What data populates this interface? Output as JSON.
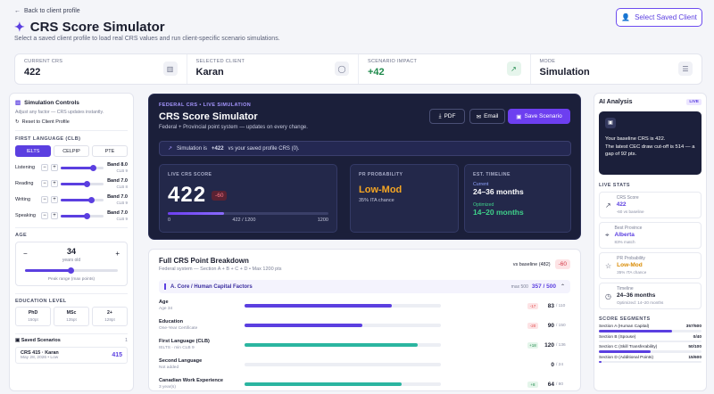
{
  "header": {
    "back_label": "Back to client profile",
    "title": "CRS Score Simulator",
    "subtitle": "Select a saved client profile to load real CRS values and run client-specific scenario simulations.",
    "select_button": "Select Saved Client"
  },
  "stats": [
    {
      "label": "CURRENT CRS",
      "value": "422",
      "icon": "chart-icon"
    },
    {
      "label": "SELECTED CLIENT",
      "value": "Karan",
      "icon": "user-icon"
    },
    {
      "label": "SCENARIO IMPACT",
      "value": "+42",
      "icon": "trend-up-icon",
      "color": "#1f8a4c"
    },
    {
      "label": "MODE",
      "value": "Simulation",
      "icon": "sliders-icon"
    }
  ],
  "controls": {
    "title": "Simulation Controls",
    "subtitle": "Adjust any factor — CRS updates instantly.",
    "reset": "Reset to Client Profile",
    "language_label": "FIRST LANGUAGE (CLB)",
    "tests": [
      "IELTS",
      "CELPIP",
      "PTE"
    ],
    "skills": [
      {
        "name": "Listening",
        "band": "Band 8.0",
        "clb": "CLB 9",
        "level": 0.75
      },
      {
        "name": "Reading",
        "band": "Band 7.0",
        "clb": "CLB 8",
        "level": 0.6
      },
      {
        "name": "Writing",
        "band": "Band 7.0",
        "clb": "CLB 9",
        "level": 0.7
      },
      {
        "name": "Speaking",
        "band": "Band 7.0",
        "clb": "CLB 9",
        "level": 0.6
      }
    ],
    "age_label": "AGE",
    "age_value": "34",
    "age_unit": "years old",
    "age_caption": "Peak range (max points)",
    "education_label": "EDUCATION LEVEL",
    "education": [
      {
        "name": "PhD",
        "pts": "150pt"
      },
      {
        "name": "MSc",
        "pts": "135pt"
      },
      {
        "name": "2+",
        "pts": "128pt"
      }
    ],
    "saved_label": "Saved Scenarios",
    "saved_count": "1",
    "saved_item": {
      "name": "CRS 415 · Karan",
      "meta": "May 28, 2026 • Low",
      "score": "415"
    }
  },
  "hero": {
    "tag": "FEDERAL CRS • LIVE SIMULATION",
    "title": "CRS Score Simulator",
    "subtitle": "Federal + Provincial point system — updates on every change.",
    "pdf": "PDF",
    "email": "Email",
    "save": "Save Scenario",
    "banner_pre": "Simulation is",
    "banner_bold": "+422",
    "banner_post": "vs your saved profile CRS (0).",
    "live_label": "LIVE CRS SCORE",
    "live_value": "422",
    "live_delta": "-60",
    "bar_min": "0",
    "bar_mid": "422 / 1200",
    "bar_max": "1200",
    "live_fraction": 0.352,
    "prob_label": "PR PROBABILITY",
    "prob_value": "Low-Mod",
    "prob_sub": "35% ITA chance",
    "timeline_label": "EST. TIMELINE",
    "current_label": "Current",
    "current_value": "24–36 months",
    "optimized_label": "Optimized",
    "optimized_value": "14–20 months"
  },
  "breakdown": {
    "title": "Full CRS Point Breakdown",
    "subtitle": "Federal system — Section A + B + C + D • Max 1200 pts",
    "baseline": "vs baseline (482)",
    "baseline_delta": "-60",
    "section": "A. Core / Human Capital Factors",
    "section_max": "max 500",
    "section_score": "357 / 500",
    "rows": [
      {
        "name": "Age",
        "sub": "Age 34",
        "delta": "-17",
        "value": "83",
        "max": "/ 110",
        "fill": 0.75,
        "color": "#5b3fe0",
        "dcolor": "#e04a4a"
      },
      {
        "name": "Education",
        "sub": "One-Year Certificate",
        "delta": "-20",
        "value": "90",
        "max": "/ 150",
        "fill": 0.6,
        "color": "#5b3fe0",
        "dcolor": "#e04a4a"
      },
      {
        "name": "First Language (CLB)",
        "sub": "IELTS - min CLB 9",
        "delta": "+18",
        "value": "120",
        "max": "/ 136",
        "fill": 0.88,
        "color": "#2bb5a0",
        "dcolor": "#1f8a4c"
      },
      {
        "name": "Second Language",
        "sub": "Not added",
        "delta": "",
        "value": "0",
        "max": "/ 24",
        "fill": 0,
        "color": "#5b3fe0",
        "dcolor": "#8a8fa5"
      },
      {
        "name": "Canadian Work Experience",
        "sub": "3 year(s)",
        "delta": "+8",
        "value": "64",
        "max": "/ 80",
        "fill": 0.8,
        "color": "#2bb5a0",
        "dcolor": "#1f8a4c"
      }
    ]
  },
  "ai": {
    "title": "AI Analysis",
    "badge": "LIVE",
    "line1": "Your baseline CRS is 422.",
    "line2": "The latest CEC draw cut-off is 514 — a gap of 92 pts."
  },
  "live_stats": {
    "label": "LIVE STATS",
    "items": [
      {
        "icon": "trend-up-icon",
        "label": "CRS Score",
        "value": "422",
        "sub": "-60 vs baseline"
      },
      {
        "icon": "location-pin-icon",
        "label": "Best Province",
        "value": "Alberta",
        "sub": "83% match"
      },
      {
        "icon": "star-icon",
        "label": "PR Probability",
        "value": "Low-Mod",
        "sub": "35% ITA chance",
        "color": "#d98a00"
      },
      {
        "icon": "clock-icon",
        "label": "Timeline",
        "value": "24–36 months",
        "sub": "Optimized: 14–20 months",
        "color": "#1a1d2e"
      }
    ]
  },
  "segments": {
    "label": "SCORE SEGMENTS",
    "items": [
      {
        "name": "Section A (Human Capital)",
        "value": "357/500",
        "fill": 0.714
      },
      {
        "name": "Section B (Spouse)",
        "value": "0/40",
        "fill": 0
      },
      {
        "name": "Section C (Skill Transferability)",
        "value": "50/100",
        "fill": 0.5
      },
      {
        "name": "Section D (Additional Points)",
        "value": "15/600",
        "fill": 0.025
      }
    ]
  }
}
